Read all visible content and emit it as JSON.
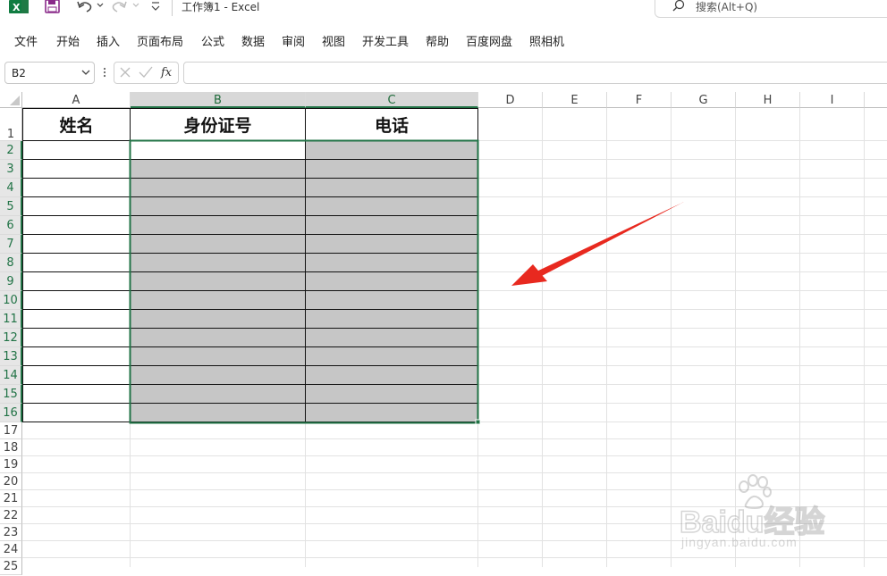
{
  "titlebar": {
    "doc_title": "工作簿1  -  Excel",
    "search_placeholder": "搜索(Alt+Q)"
  },
  "menu": [
    "文件",
    "开始",
    "插入",
    "页面布局",
    "公式",
    "数据",
    "审阅",
    "视图",
    "开发工具",
    "帮助",
    "百度网盘",
    "照相机"
  ],
  "formula_bar": {
    "name_box": "B2",
    "formula": ""
  },
  "columns": [
    "A",
    "B",
    "C",
    "D",
    "E",
    "F",
    "G",
    "H",
    "I"
  ],
  "rows": [
    "1",
    "2",
    "3",
    "4",
    "5",
    "6",
    "7",
    "8",
    "9",
    "10",
    "11",
    "12",
    "13",
    "14",
    "15",
    "16",
    "17",
    "18",
    "19",
    "20",
    "21",
    "22",
    "23",
    "24",
    "25"
  ],
  "table_headers": [
    "姓名",
    "身份证号",
    "电话"
  ],
  "selection": "B2:C16",
  "colors": {
    "accent": "#217346",
    "selection_fill": "#c6c6c6",
    "arrow": "#e8291f"
  },
  "watermark": {
    "brand": "Baidu经验",
    "url": "jingyan.baidu.com"
  }
}
